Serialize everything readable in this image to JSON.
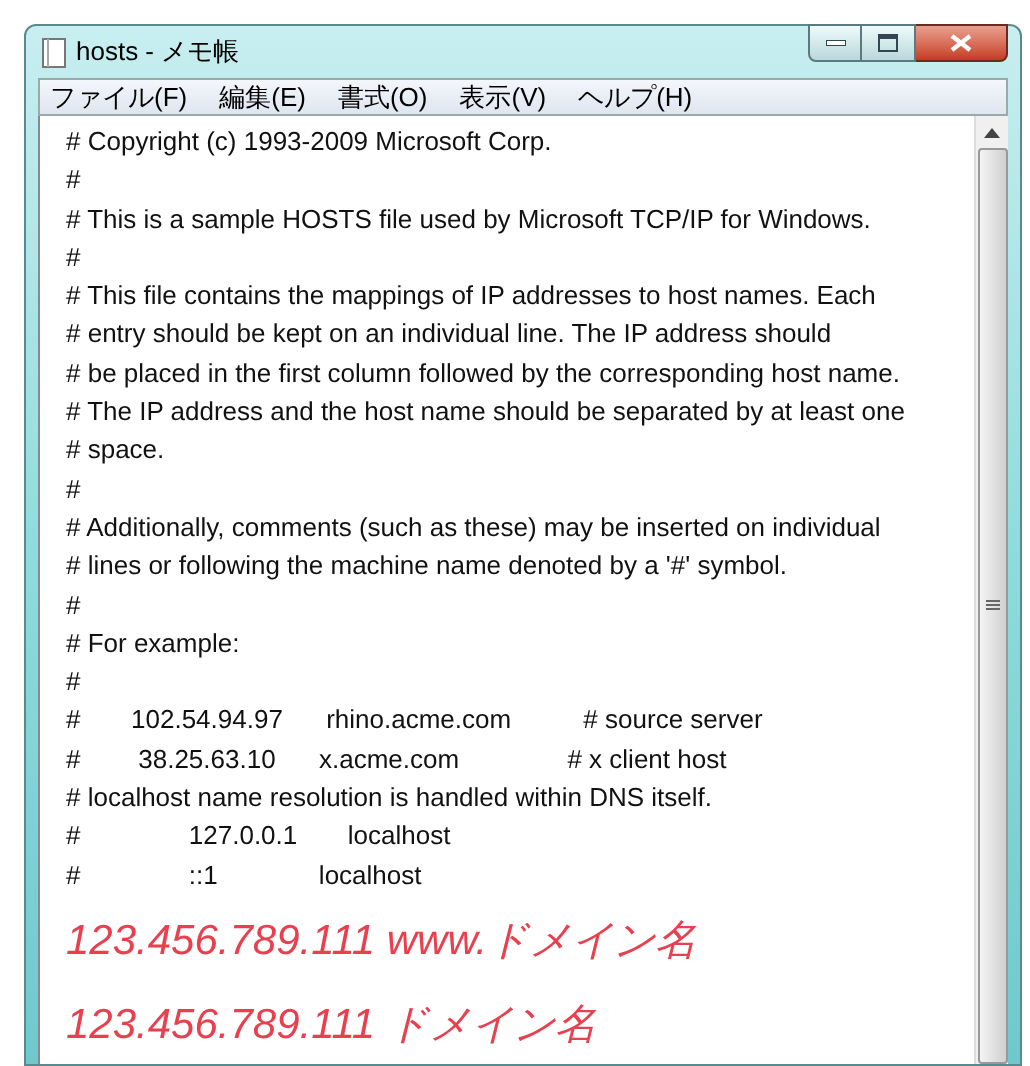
{
  "window": {
    "title": "hosts - メモ帳"
  },
  "menu": [
    "ファイル(F)",
    "編集(E)",
    "書式(O)",
    "表示(V)",
    "ヘルプ(H)"
  ],
  "lines": [
    {
      "kind": "text",
      "text": "# Copyright (c) 1993-2009 Microsoft Corp."
    },
    {
      "kind": "text",
      "text": "#"
    },
    {
      "kind": "text",
      "text": "# This is a sample HOSTS file used by Microsoft TCP/IP for Windows."
    },
    {
      "kind": "text",
      "text": "#"
    },
    {
      "kind": "text",
      "text": "# This file contains the mappings of IP addresses to host names. Each"
    },
    {
      "kind": "text",
      "text": "# entry should be kept on an individual line. The IP address should"
    },
    {
      "kind": "text",
      "text": "# be placed in the first column followed by the corresponding host name."
    },
    {
      "kind": "text",
      "text": "# The IP address and the host name should be separated by at least one"
    },
    {
      "kind": "text",
      "text": "# space."
    },
    {
      "kind": "text",
      "text": "#"
    },
    {
      "kind": "text",
      "text": "# Additionally, comments (such as these) may be inserted on individual"
    },
    {
      "kind": "text",
      "text": "# lines or following the machine name denoted by a '#' symbol."
    },
    {
      "kind": "text",
      "text": "#"
    },
    {
      "kind": "text",
      "text": "# For example:"
    },
    {
      "kind": "text",
      "text": "#"
    },
    {
      "kind": "text",
      "text": "#       102.54.94.97      rhino.acme.com          # source server"
    },
    {
      "kind": "text",
      "text": "#        38.25.63.10      x.acme.com               # x client host"
    },
    {
      "kind": "text",
      "text": "# localhost name resolution is handled within DNS itself."
    },
    {
      "kind": "text",
      "text": "#               127.0.0.1       localhost"
    },
    {
      "kind": "text",
      "text": "#               ::1              localhost"
    },
    {
      "kind": "highlight",
      "text": "123.456.789.111 www.ドメイン名"
    },
    {
      "kind": "highlight",
      "text": "123.456.789.111 ドメイン名"
    }
  ]
}
